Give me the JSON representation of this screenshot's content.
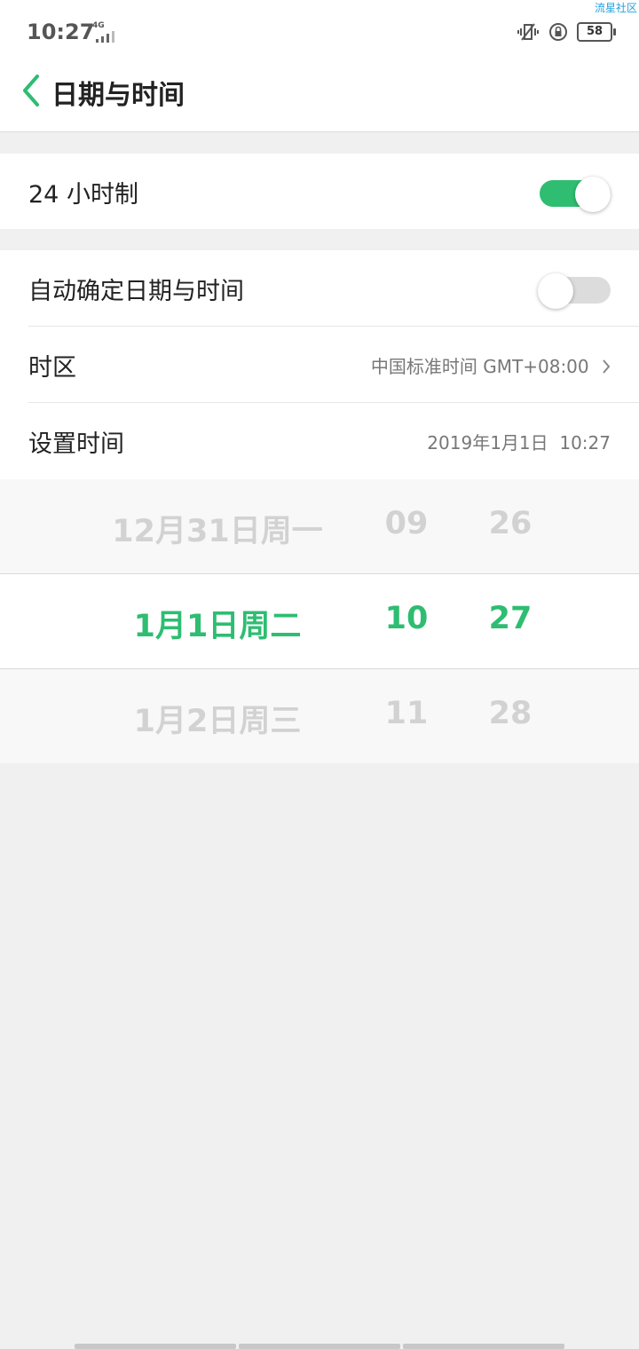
{
  "status_bar": {
    "time": "10:27",
    "network": "4G",
    "battery": "58",
    "watermark": "流星社区",
    "icons": [
      "vibrate-icon",
      "rotation-lock-icon",
      "battery-icon"
    ]
  },
  "header": {
    "title": "日期与时间",
    "back_icon": "chevron-left-icon"
  },
  "settings": {
    "hour24": {
      "label": "24 小时制",
      "enabled": true
    },
    "auto_datetime": {
      "label": "自动确定日期与时间",
      "enabled": false
    },
    "timezone": {
      "label": "时区",
      "value": "中国标准时间 GMT+08:00"
    },
    "set_time": {
      "label": "设置时间",
      "value": "2019年1月1日  10:27"
    }
  },
  "picker": {
    "prev": {
      "date": "12月31日周一",
      "hour": "09",
      "minute": "26"
    },
    "selected": {
      "date": "1月1日周二",
      "hour": "10",
      "minute": "27"
    },
    "next": {
      "date": "1月2日周三",
      "hour": "11",
      "minute": "28"
    }
  },
  "colors": {
    "accent": "#2ebd71",
    "background": "#f0f0f0"
  }
}
